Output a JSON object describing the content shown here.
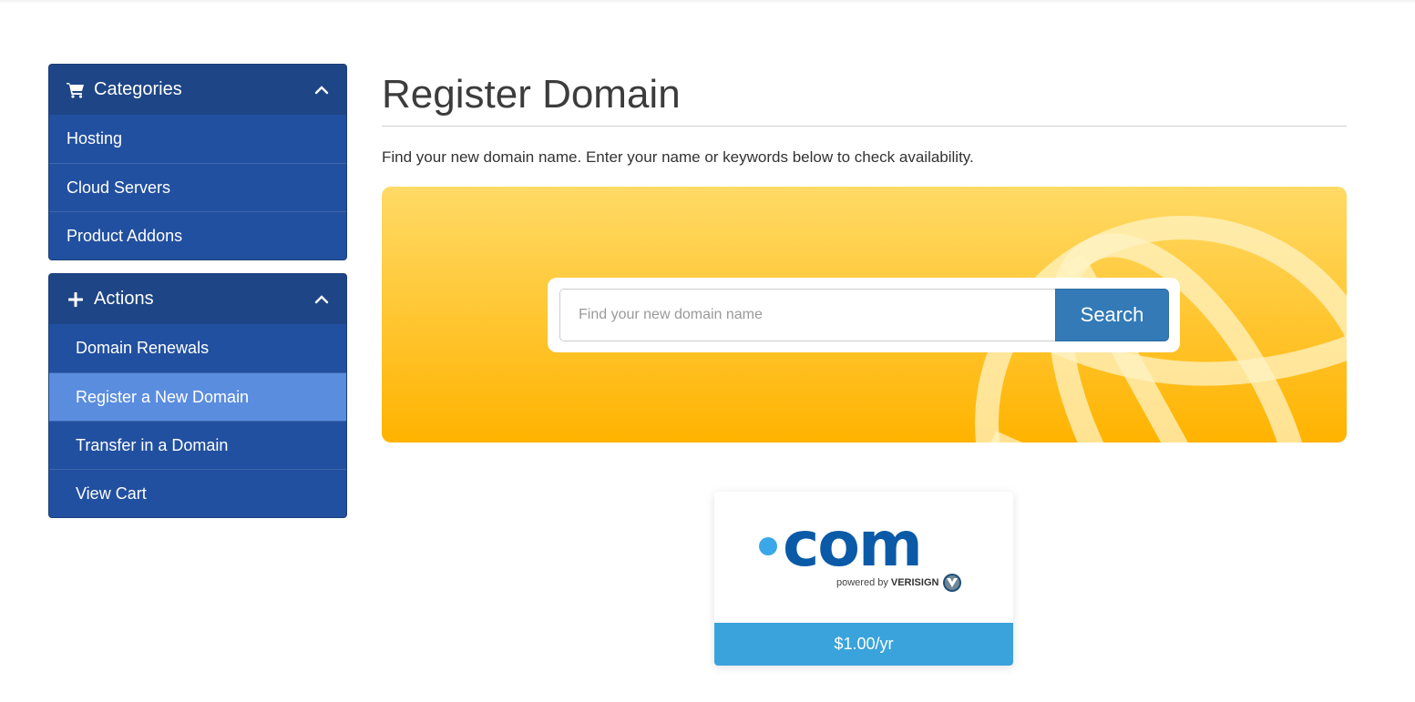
{
  "sidebar": {
    "categories": {
      "title": "Categories",
      "icon": "shopping-cart-icon",
      "items": [
        {
          "label": "Hosting"
        },
        {
          "label": "Cloud Servers"
        },
        {
          "label": "Product Addons"
        }
      ]
    },
    "actions": {
      "title": "Actions",
      "icon": "plus-icon",
      "items": [
        {
          "label": "Domain Renewals",
          "active": false
        },
        {
          "label": "Register a New Domain",
          "active": true
        },
        {
          "label": "Transfer in a Domain",
          "active": false
        },
        {
          "label": "View Cart",
          "active": false
        }
      ]
    }
  },
  "main": {
    "title": "Register Domain",
    "subtitle": "Find your new domain name. Enter your name or keywords below to check availability.",
    "search": {
      "placeholder": "Find your new domain name",
      "value": "",
      "button_label": "Search"
    },
    "featured_tld": {
      "name": "com",
      "powered_by": "powered by",
      "brand": "VERISIGN",
      "price": "$1.00/yr"
    }
  },
  "colors": {
    "sidebar_bg": "#2250a0",
    "sidebar_header": "#1e4585",
    "sidebar_active": "#5b8ddf",
    "banner_top": "#ffda66",
    "banner_bottom": "#ffb300",
    "search_button": "#337ab7",
    "price_bar": "#3aa3dc",
    "tld_blue": "#0b5aa7"
  }
}
